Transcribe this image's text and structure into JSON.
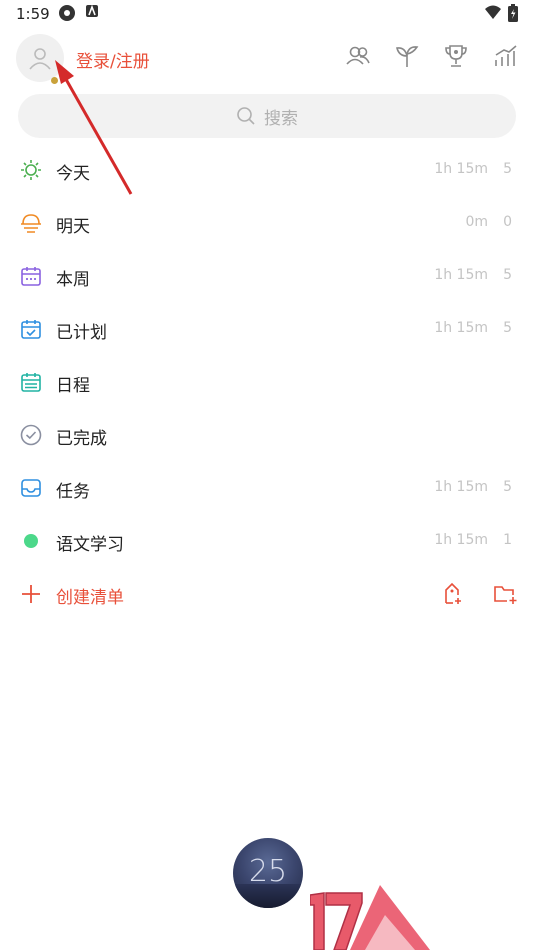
{
  "status_bar": {
    "time": "1:59"
  },
  "header": {
    "login_label": "登录/注册"
  },
  "search": {
    "placeholder": "搜索"
  },
  "lists": [
    {
      "label": "今天",
      "icon": "sun-icon",
      "duration": "1h 15m",
      "count": "5",
      "color": "#4caf50"
    },
    {
      "label": "明天",
      "icon": "sunset-icon",
      "duration": "0m",
      "count": "0",
      "color": "#f08a24"
    },
    {
      "label": "本周",
      "icon": "calendar-week-icon",
      "duration": "1h 15m",
      "count": "5",
      "color": "#8a62e0"
    },
    {
      "label": "已计划",
      "icon": "calendar-check-icon",
      "duration": "1h 15m",
      "count": "5",
      "color": "#2e8fe0"
    },
    {
      "label": "日程",
      "icon": "calendar-grid-icon",
      "duration": "",
      "count": "",
      "color": "#21b3a3"
    },
    {
      "label": "已完成",
      "icon": "check-circle-icon",
      "duration": "",
      "count": "",
      "color": "#8a8fa0"
    },
    {
      "label": "任务",
      "icon": "inbox-icon",
      "duration": "1h 15m",
      "count": "5",
      "color": "#2e8fe0"
    },
    {
      "label": "语文学习",
      "icon": "green-dot-icon",
      "duration": "1h 15m",
      "count": "1",
      "color": "#4cd88a"
    }
  ],
  "create_list": {
    "label": "创建清单",
    "color": "#e8503a"
  },
  "timer": {
    "value": "25"
  },
  "watermark": {
    "text": "17"
  },
  "colors": {
    "accent": "#e8503a",
    "muted": "#c4c4c4"
  }
}
